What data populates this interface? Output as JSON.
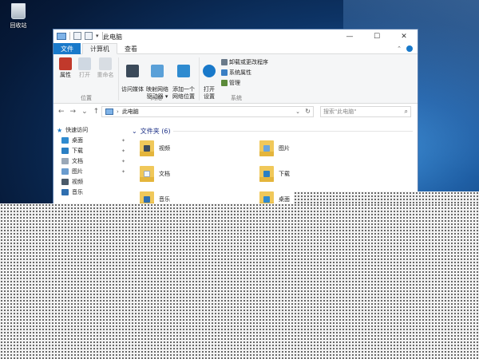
{
  "desktop": {
    "recycle_bin_label": "回收站"
  },
  "window": {
    "title": "此电脑",
    "qat_dropdown": "▾",
    "controls": {
      "minimize": "—",
      "maximize": "☐",
      "close": "✕"
    }
  },
  "ribbon": {
    "tabs": [
      {
        "label": "文件"
      },
      {
        "label": "计算机",
        "active": true
      },
      {
        "label": "查看"
      }
    ],
    "collapse_chevron": "⌃",
    "groups": {
      "location": {
        "label": "位置",
        "buttons": [
          {
            "label": "属性"
          },
          {
            "label": "打开"
          },
          {
            "label": "重命名"
          }
        ]
      },
      "network": {
        "label": "网络",
        "buttons": [
          {
            "label": "访问媒体"
          },
          {
            "label": "映射网络\n驱动器 ▾"
          },
          {
            "label": "添加一个\n网络位置"
          }
        ]
      },
      "system": {
        "label": "系统",
        "open_settings": "打开\n设置",
        "items": [
          {
            "label": "卸载或更改程序"
          },
          {
            "label": "系统属性"
          },
          {
            "label": "管理"
          }
        ]
      }
    }
  },
  "addressbar": {
    "back": "←",
    "forward": "→",
    "dropdown": "⌄",
    "up": "↑",
    "chevron": "›",
    "path": "此电脑",
    "refresh": "↻",
    "search_placeholder": "搜索\"此电脑\"",
    "search_icon": "⌕"
  },
  "navpane": {
    "quick_access": "快速访问",
    "pin": "✦",
    "items": [
      {
        "label": "桌面",
        "icon": "desktop-icon",
        "pinned": true
      },
      {
        "label": "下载",
        "icon": "download-icon",
        "pinned": true
      },
      {
        "label": "文档",
        "icon": "document-icon",
        "pinned": true
      },
      {
        "label": "图片",
        "icon": "picture-icon",
        "pinned": true
      },
      {
        "label": "视频",
        "icon": "video-icon",
        "pinned": false
      },
      {
        "label": "音乐",
        "icon": "music-icon",
        "pinned": false
      }
    ]
  },
  "content": {
    "section_title": "文件夹 (6)",
    "section_chevron": "⌄",
    "folders": [
      {
        "label": "视频"
      },
      {
        "label": "图片"
      },
      {
        "label": "文档"
      },
      {
        "label": "下载"
      },
      {
        "label": "音乐"
      },
      {
        "label": "桌面"
      }
    ]
  },
  "colors": {
    "accent": "#1979ca",
    "folder": "#f0c85a",
    "section_title": "#1e3287"
  }
}
